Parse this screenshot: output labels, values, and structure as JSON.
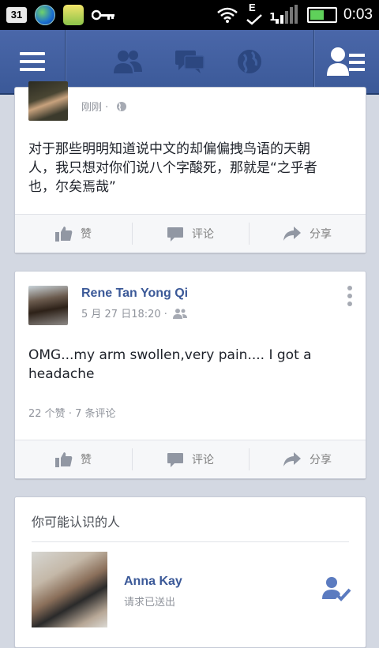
{
  "status_bar": {
    "badge": "31",
    "network": "E",
    "signal_digits": "1",
    "time": "0:03"
  },
  "top_nav": {
    "icons": [
      "menu-icon",
      "friends-icon",
      "messages-icon",
      "notifications-globe-icon",
      "friend-requests-icon"
    ]
  },
  "posts": [
    {
      "time": "刚刚 ·",
      "text_lines": [
        "对于那些明明知道说中文的却偏偏拽鸟语的天朝",
        "人，我只想对你们说八个字酸死，那就是“之乎者",
        "也，尔矣焉哉”"
      ],
      "actions": {
        "like": "赞",
        "comment": "评论",
        "share": "分享"
      }
    },
    {
      "author": "Rene Tan Yong Qi",
      "time": "5 月 27 日18:20 ·",
      "text_lines": [
        "OMG...my arm swollen,very pain.... I got a",
        "headache"
      ],
      "likes": "22 个赞",
      "dot": "·",
      "comments": "7 条评论",
      "actions": {
        "like": "赞",
        "comment": "评论",
        "share": "分享"
      }
    }
  ],
  "pymk": {
    "title": "你可能认识的人",
    "person_name": "Anna Kay",
    "person_status": "请求已送出"
  },
  "colors": {
    "brand": "#3b5998",
    "background": "#d3d8e2"
  }
}
